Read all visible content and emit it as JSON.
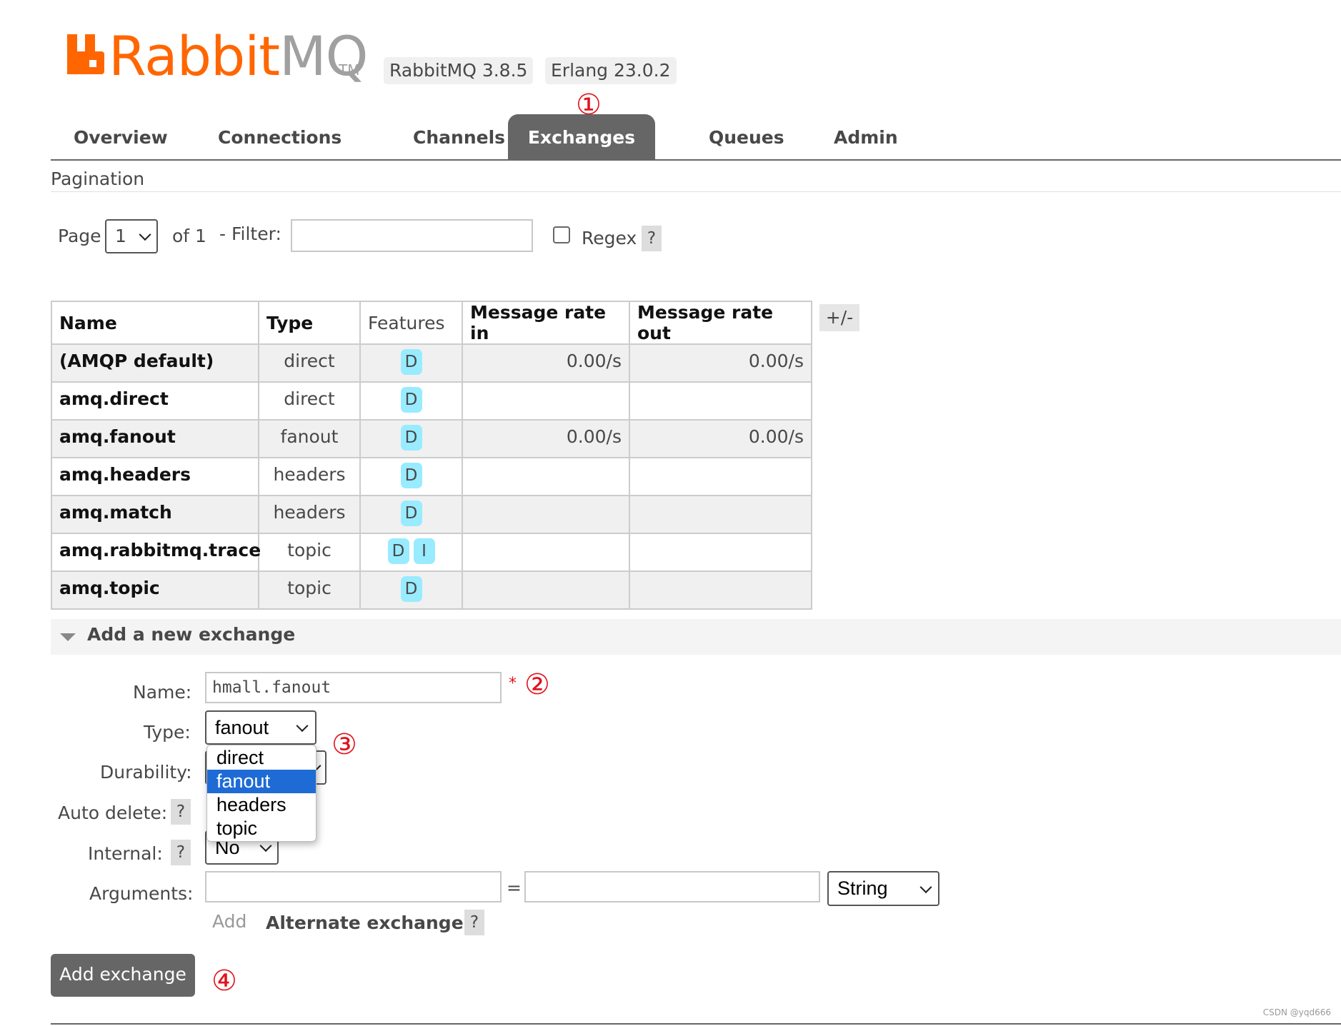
{
  "header": {
    "logo_main": "Rabbit",
    "logo_suffix": "MQ",
    "logo_tm": "TM",
    "logo_color": "#ff6600",
    "version_badges": [
      "RabbitMQ 3.8.5",
      "Erlang 23.0.2"
    ]
  },
  "nav": {
    "tabs": [
      {
        "label": "Overview",
        "active": false
      },
      {
        "label": "Connections",
        "active": false
      },
      {
        "label": "Channels",
        "active": false
      },
      {
        "label": "Exchanges",
        "active": true
      },
      {
        "label": "Queues",
        "active": false
      },
      {
        "label": "Admin",
        "active": false
      }
    ]
  },
  "annotations": [
    "①",
    "②",
    "③",
    "④"
  ],
  "pagination": {
    "section_title": "Pagination",
    "page_label": "Page",
    "page_value": "1",
    "of_label": "of 1",
    "filter_label": "- Filter:",
    "filter_value": "",
    "regex_label": "Regex",
    "regex_checked": false,
    "help_label": "?"
  },
  "exchanges_table": {
    "columns": [
      "Name",
      "Type",
      "Features",
      "Message rate in",
      "Message rate out"
    ],
    "columns_toggle": "+/-",
    "rows": [
      {
        "name": "(AMQP default)",
        "type": "direct",
        "features": [
          "D"
        ],
        "rate_in": "0.00/s",
        "rate_out": "0.00/s"
      },
      {
        "name": "amq.direct",
        "type": "direct",
        "features": [
          "D"
        ],
        "rate_in": "",
        "rate_out": ""
      },
      {
        "name": "amq.fanout",
        "type": "fanout",
        "features": [
          "D"
        ],
        "rate_in": "0.00/s",
        "rate_out": "0.00/s"
      },
      {
        "name": "amq.headers",
        "type": "headers",
        "features": [
          "D"
        ],
        "rate_in": "",
        "rate_out": ""
      },
      {
        "name": "amq.match",
        "type": "headers",
        "features": [
          "D"
        ],
        "rate_in": "",
        "rate_out": ""
      },
      {
        "name": "amq.rabbitmq.trace",
        "type": "topic",
        "features": [
          "D",
          "I"
        ],
        "rate_in": "",
        "rate_out": ""
      },
      {
        "name": "amq.topic",
        "type": "topic",
        "features": [
          "D"
        ],
        "rate_in": "",
        "rate_out": ""
      }
    ]
  },
  "add_exchange": {
    "title": "Add a new exchange",
    "name_label": "Name:",
    "name_value": "hmall.fanout",
    "required_mark": "*",
    "type_label": "Type:",
    "type_value": "fanout",
    "type_options": [
      "direct",
      "fanout",
      "headers",
      "topic"
    ],
    "durability_label": "Durability:",
    "auto_delete_label": "Auto delete:",
    "internal_label": "Internal:",
    "internal_value": "No",
    "arguments_label": "Arguments:",
    "arguments_equals": "=",
    "arguments_type": "String",
    "add_link": "Add",
    "alternate_exchange": "Alternate exchange",
    "help_label": "?",
    "submit_label": "Add exchange"
  },
  "watermark": "CSDN @yqd666"
}
